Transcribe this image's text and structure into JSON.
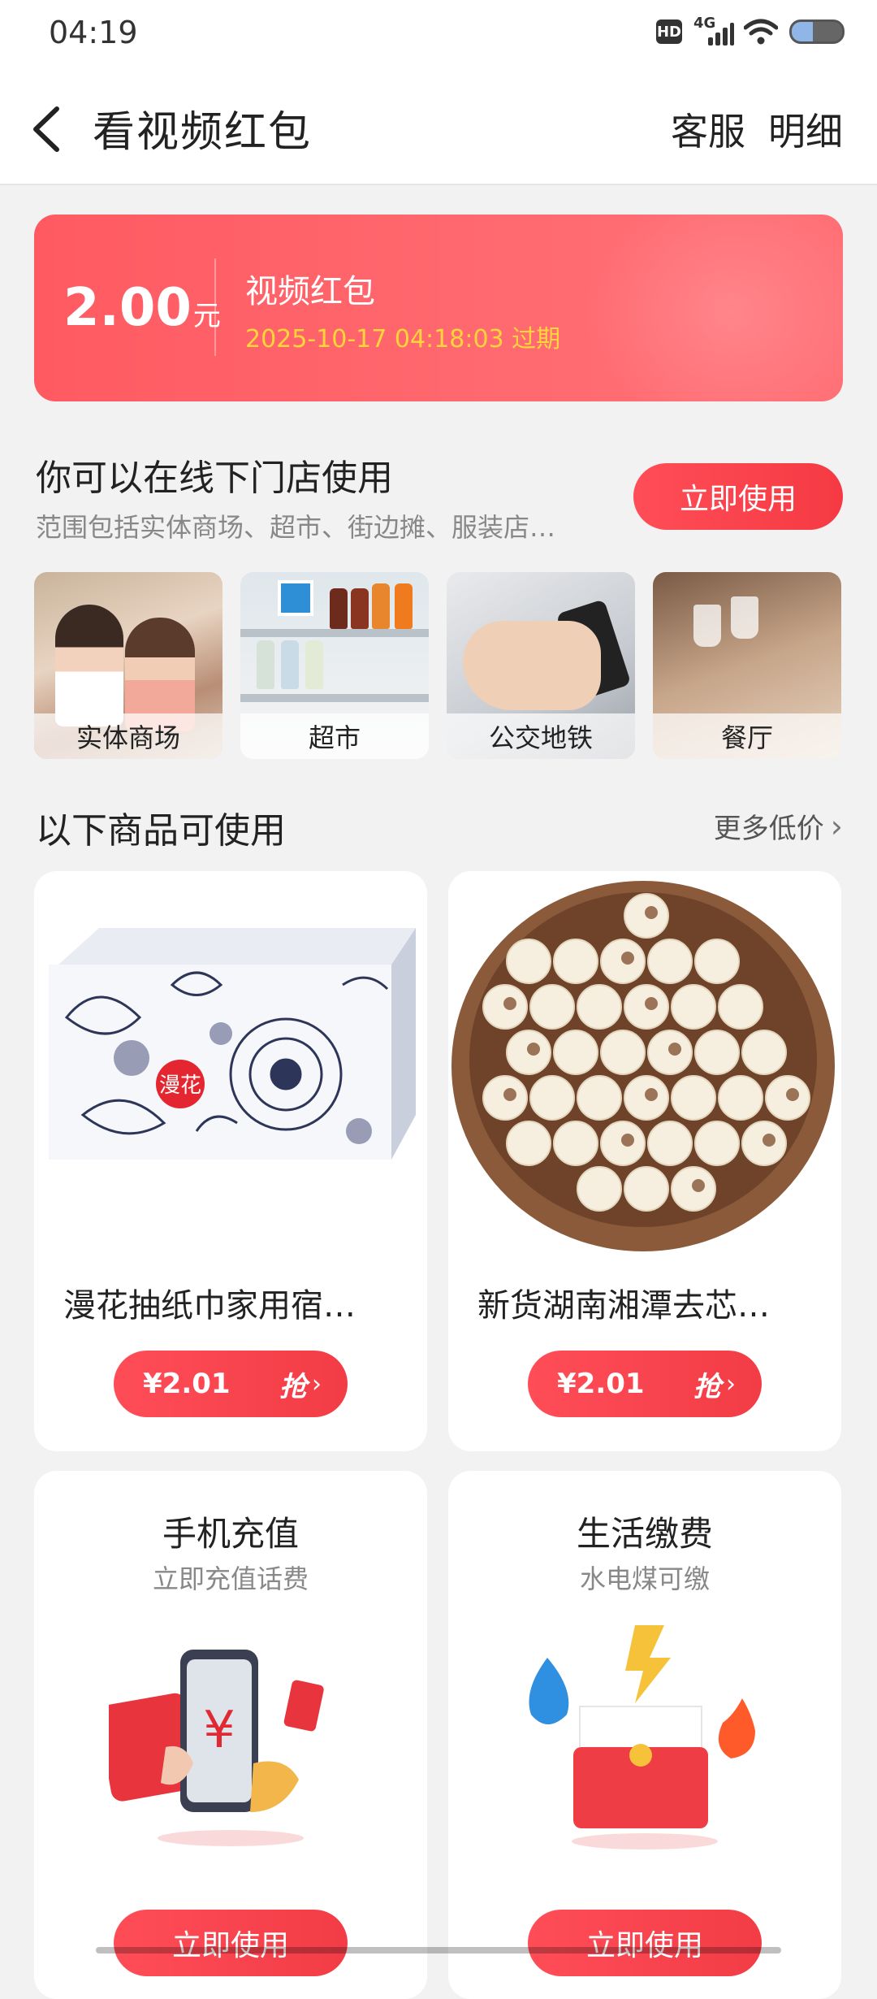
{
  "status_bar": {
    "time": "04:19",
    "hd": "HD",
    "network": "4G"
  },
  "header": {
    "title": "看视频红包",
    "service": "客服",
    "details": "明细"
  },
  "coupon": {
    "amount": "2.00",
    "unit": "元",
    "title": "视频红包",
    "expiry": "2025-10-17 04:18:03 过期"
  },
  "use_section": {
    "title": "你可以在线下门店使用",
    "subtitle": "范围包括实体商场、超市、街边摊、服装店…",
    "button": "立即使用"
  },
  "scenes": [
    {
      "label": "实体商场"
    },
    {
      "label": "超市"
    },
    {
      "label": "公交地铁"
    },
    {
      "label": "餐厅"
    }
  ],
  "products_header": {
    "title": "以下商品可使用",
    "more": "更多低价"
  },
  "products": [
    {
      "name": "漫花抽纸巾家用宿…",
      "price": "¥2.01",
      "action": "抢",
      "brand": "漫花"
    },
    {
      "name": "新货湖南湘潭去芯…",
      "price": "¥2.01",
      "action": "抢"
    }
  ],
  "services": [
    {
      "title": "手机充值",
      "subtitle": "立即充值话费",
      "button": "立即使用"
    },
    {
      "title": "生活缴费",
      "subtitle": "水电煤可缴",
      "button": "立即使用"
    }
  ],
  "colors": {
    "accent": "#f53a43",
    "coupon_bg": "#ff5e66",
    "expiry": "#ffd53a"
  }
}
